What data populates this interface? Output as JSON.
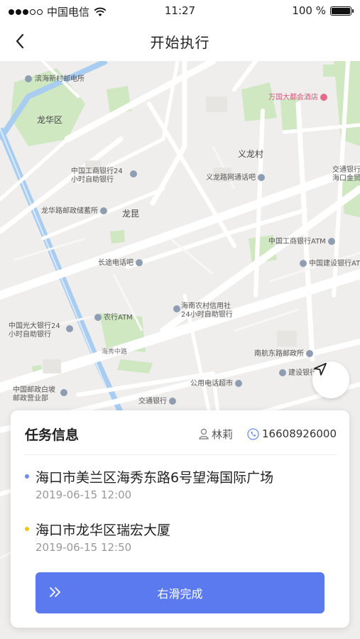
{
  "status_bar": {
    "carrier": "中国电信",
    "time": "11:27",
    "battery_percent": "100 %",
    "battery_level": 1.0,
    "signal_bars_filled": 3,
    "signal_bars_total": 5
  },
  "nav": {
    "title": "开始执行",
    "back_icon": "chevron-left-icon"
  },
  "map": {
    "labels": {
      "binhai_post": "滨海新村邮电所",
      "longhua_district": "龙华区",
      "wanguo_hotel": "万国大都会酒店",
      "yilong_village": "义龙村",
      "icbc_24": "中国工商银行24\n小时自助银行",
      "yilong_internet": "义龙路网通话吧",
      "bocom_right": "交通银行\n海口金贸",
      "longhua_postal": "龙华路邮政储蓄所",
      "longkun": "龙昆",
      "icbc_atm": "中国工商银行ATM",
      "ccb_atm": "中国建设银行ATM",
      "changsu_phone": "长途电话吧",
      "hainan_rcb": "海南农村信用社\n24小时自助银行",
      "ceb_24": "中国光大银行24\n小时自助银行",
      "abc_atm": "农行ATM",
      "nanhang_post": "南航东路邮政所",
      "ccb": "建设银行",
      "china_post_bc": "中国邮政白坡\n邮政营业部",
      "public_phone_market": "公用电话超市",
      "bocom": "交通银行",
      "haixiu_road": "海秀中路"
    },
    "colors": {
      "background": "#efeeec",
      "road": "#ffffff",
      "green": "#cfe8c2",
      "water": "#a8cdf0"
    }
  },
  "locate_icon": "navigation-arrow-icon",
  "task_card": {
    "title": "任务信息",
    "contact_name": "林莉",
    "contact_phone": "16608926000",
    "person_icon": "person-icon",
    "phone_icon": "phone-icon",
    "stops": [
      {
        "address": "海口市美兰区海秀东路6号望海国际广场",
        "time": "2019-06-15   12:00",
        "dot_color": "#6b8cf0"
      },
      {
        "address": "海口市龙华区瑞宏大厦",
        "time": "2019-06-15   12:50",
        "dot_color": "#f5c21b"
      }
    ],
    "slide_button": {
      "label": "右滑完成",
      "icon": "double-chevron-right-icon",
      "color": "#5b7af0"
    }
  }
}
